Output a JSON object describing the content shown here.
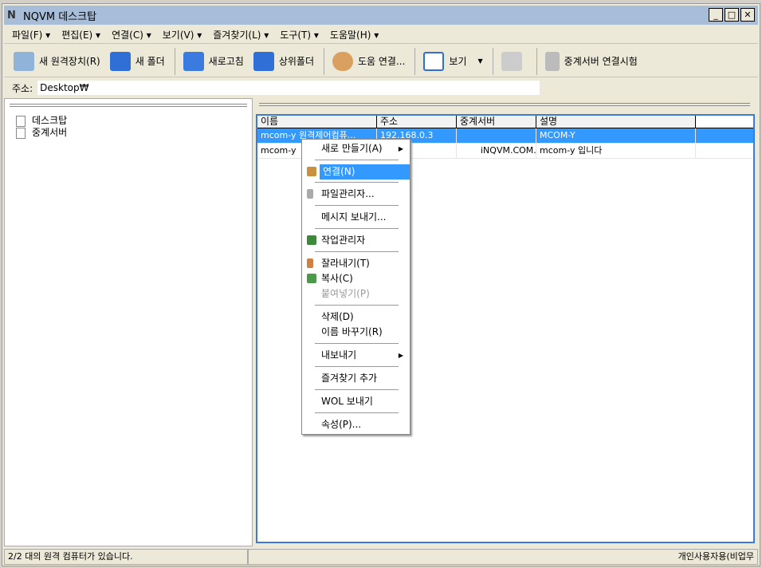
{
  "window": {
    "title": "NQVM 데스크탑",
    "minimize": "_",
    "maximize": "□",
    "close": "✕"
  },
  "menubar": [
    "파일(F) ▾",
    "편집(E) ▾",
    "연결(C) ▾",
    "보기(V) ▾",
    "즐겨찾기(L) ▾",
    "도구(T) ▾",
    "도움말(H) ▾"
  ],
  "toolbar": {
    "new_device": "새 원격장치(R)",
    "new_folder": "새 폴더",
    "refresh": "새로고침",
    "parent": "상위폴더",
    "help_connect": "도움 연결...",
    "view": "보기",
    "relay_test": "중계서버 연결시험"
  },
  "address": {
    "label": "주소:",
    "value": "Desktop₩"
  },
  "tree": [
    "데스크탑",
    "중계서버"
  ],
  "list": {
    "columns": [
      "이름",
      "주소",
      "중계서버",
      "설명"
    ],
    "rows": [
      [
        "mcom-y 원격제어컴퓨...",
        "192.168.0.3",
        "",
        "MCOM-Y"
      ],
      [
        "mcom-y",
        "",
        "iNQVM.COM...",
        "mcom-y 입니다"
      ]
    ]
  },
  "context_menu": [
    "새로 만들기(A)",
    "연결(N)",
    "파일관리자...",
    "메시지 보내기...",
    "작업관리자",
    "잘라내기(T)",
    "복사(C)",
    "붙여넣기(P)",
    "삭제(D)",
    "이름 바꾸기(R)",
    "내보내기",
    "즐겨찾기 추가",
    "WOL 보내기",
    "속성(P)..."
  ],
  "status": {
    "left": "2/2 대의 원격 컴퓨터가 있습니다.",
    "right": "개인사용자용(비업무"
  }
}
